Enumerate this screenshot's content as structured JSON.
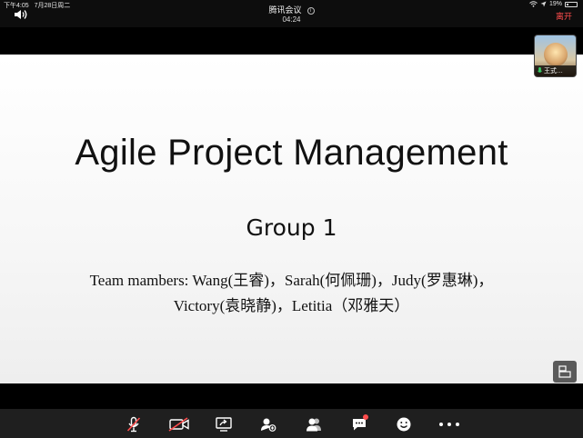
{
  "status_bar": {
    "time": "下午4:05",
    "date": "7月28日周二",
    "battery": "19%"
  },
  "meeting": {
    "app_title": "腾讯会议",
    "elapsed": "04:24",
    "leave_label": "离开"
  },
  "slide": {
    "title": "Agile Project Management",
    "subtitle": "Group 1",
    "members_line1": "Team mambers: Wang(王睿)，Sarah(何佩珊)，Judy(罗惠琳)，",
    "members_line2": "Victory(袁晓静)，Letitia（邓雅天）"
  },
  "participant": {
    "name": "王式…"
  },
  "toolbar": {
    "icons": [
      "mic-muted-icon",
      "camera-off-icon",
      "share-screen-icon",
      "invite-icon",
      "participants-icon",
      "chat-icon",
      "reaction-icon",
      "more-icon"
    ]
  },
  "colors": {
    "leave": "#ff4d4d",
    "muted": "#ff4d4d",
    "toolbar_bg": "#1f1f1f"
  }
}
